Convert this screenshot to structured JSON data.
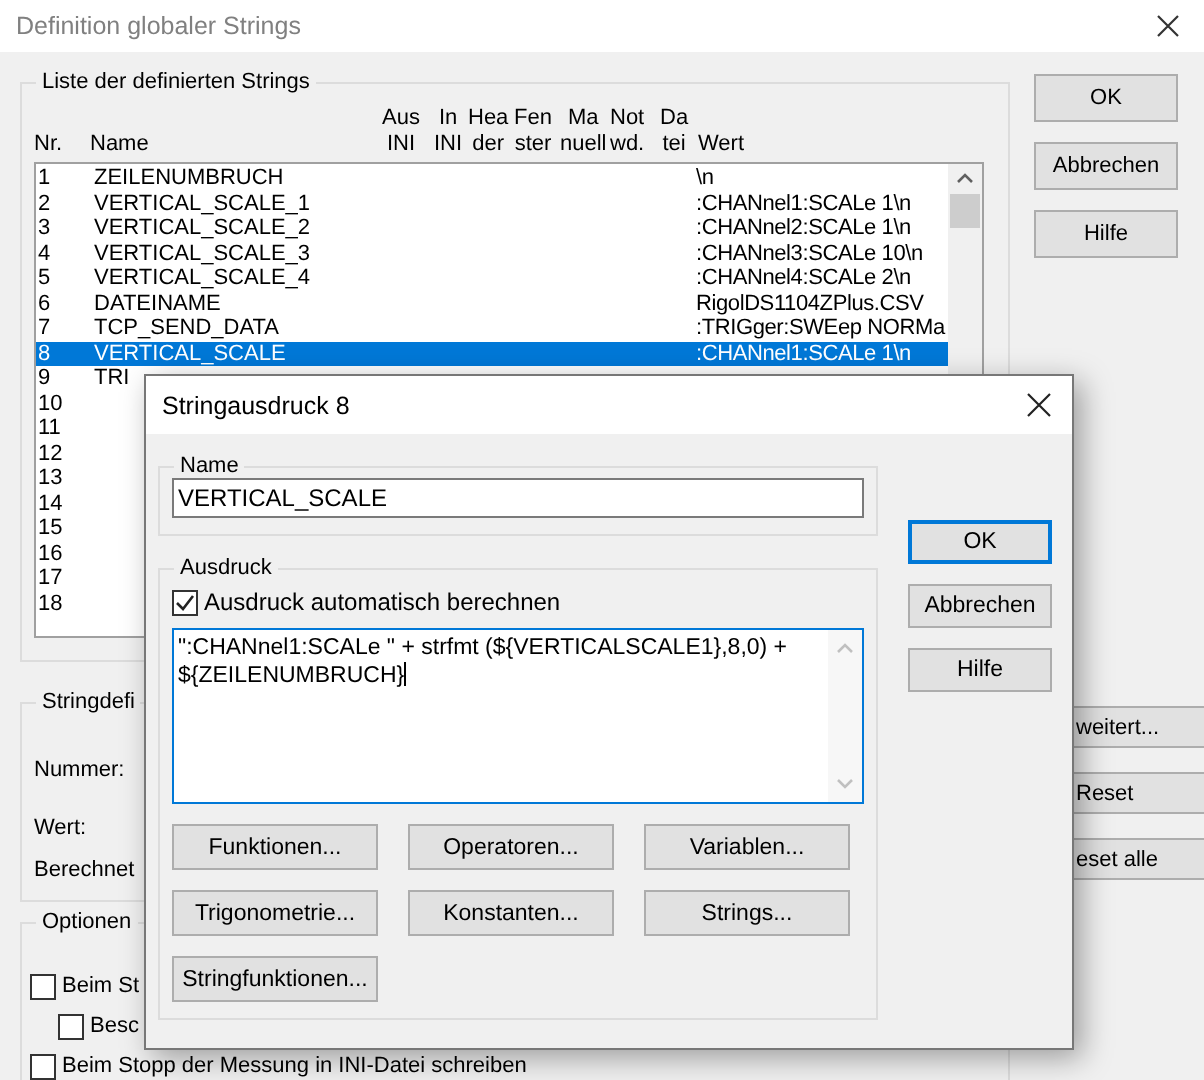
{
  "window": {
    "title": "Definition globaler Strings"
  },
  "string_list": {
    "title": "Liste der definierten Strings",
    "columns": [
      "Nr.",
      "Name",
      "Aus\nINI",
      "In\nINI",
      "Hea\nder",
      "Fen\nster",
      "Ma\nnuell",
      "Not\nwd.",
      "Da\ntei",
      "Wert"
    ],
    "rows": [
      {
        "nr": "1",
        "name": "ZEILENUMBRUCH",
        "value": "\\n",
        "selected": false
      },
      {
        "nr": "2",
        "name": "VERTICAL_SCALE_1",
        "value": ":CHANnel1:SCALe 1\\n",
        "selected": false
      },
      {
        "nr": "3",
        "name": "VERTICAL_SCALE_2",
        "value": ":CHANnel2:SCALe 1\\n",
        "selected": false
      },
      {
        "nr": "4",
        "name": "VERTICAL_SCALE_3",
        "value": ":CHANnel3:SCALe 10\\n",
        "selected": false
      },
      {
        "nr": "5",
        "name": "VERTICAL_SCALE_4",
        "value": ":CHANnel4:SCALe 2\\n",
        "selected": false
      },
      {
        "nr": "6",
        "name": "DATEINAME",
        "value": "RigolDS1104ZPlus.CSV",
        "selected": false
      },
      {
        "nr": "7",
        "name": "TCP_SEND_DATA",
        "value": ":TRIGger:SWEep NORMa",
        "selected": false
      },
      {
        "nr": "8",
        "name": "VERTICAL_SCALE",
        "value": ":CHANnel1:SCALe 1\\n",
        "selected": true
      },
      {
        "nr": "9",
        "name": "TRI",
        "selected": false
      },
      {
        "nr": "10",
        "selected": false
      },
      {
        "nr": "11",
        "selected": false
      },
      {
        "nr": "12",
        "selected": false
      },
      {
        "nr": "13",
        "selected": false
      },
      {
        "nr": "14",
        "selected": false
      },
      {
        "nr": "15",
        "selected": false
      },
      {
        "nr": "16",
        "selected": false
      },
      {
        "nr": "17",
        "selected": false
      },
      {
        "nr": "18",
        "selected": false
      }
    ]
  },
  "buttons": [
    "OK",
    "Abbrechen",
    "Hilfe"
  ],
  "definition": {
    "title": "Stringdefi",
    "labels": [
      "Nummer:",
      "Wert:",
      "Berechnet"
    ],
    "buttons": [
      "weitert...",
      "Reset",
      "eset alle"
    ]
  },
  "options": {
    "title": "Optionen",
    "checkboxes": [
      {
        "label": "Beim St",
        "checked": false,
        "children": [
          {
            "label": "Besc",
            "checked": false
          }
        ]
      },
      {
        "label": "Beim Stopp der Messung in INI-Datei schreiben",
        "checked": false
      }
    ]
  },
  "dialog": {
    "title": "Stringausdruck 8",
    "name_group": {
      "title": "Name",
      "value": "VERTICAL_SCALE"
    },
    "expression_group": {
      "title": "Ausdruck",
      "auto": {
        "label": "Ausdruck automatisch berechnen",
        "checked": true
      },
      "value": "\":CHANnel1:SCALe \" + strfmt (${VERTICALSCALE1},8,0) + ${ZEILENUMBRUCH}",
      "buttons": [
        "Funktionen...",
        "Operatoren...",
        "Variablen...",
        "Trigonometrie...",
        "Konstanten...",
        "Strings...",
        "Stringfunktionen..."
      ]
    },
    "buttons": [
      {
        "label": "OK",
        "focused": true
      },
      {
        "label": "Abbrechen",
        "focused": false
      },
      {
        "label": "Hilfe",
        "focused": false
      }
    ]
  }
}
